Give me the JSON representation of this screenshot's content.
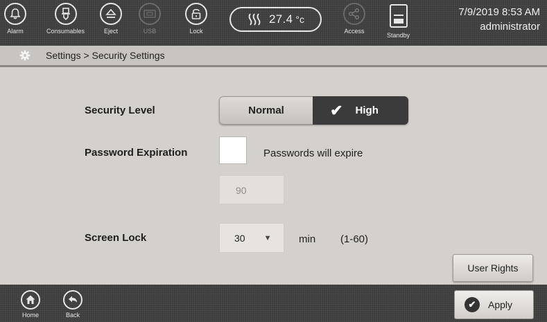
{
  "topbar": {
    "alarm_label": "Alarm",
    "consumables_label": "Consumables",
    "eject_label": "Eject",
    "usb_label": "USB",
    "lock_label": "Lock",
    "temperature": "27.4",
    "temperature_unit": "°c",
    "access_label": "Access",
    "standby_label": "Standby",
    "datetime": "7/9/2019 8:53 AM",
    "user": "administrator"
  },
  "breadcrumb": {
    "text": "Settings > Security Settings"
  },
  "security": {
    "label": "Security Level",
    "options": [
      "Normal",
      "High"
    ],
    "selected": "High"
  },
  "password": {
    "label": "Password Expiration",
    "checkbox_text": "Passwords will expire",
    "checked": false,
    "days_value": "90"
  },
  "screen_lock": {
    "label": "Screen Lock",
    "value": "30",
    "unit": "min",
    "range": "(1-60)"
  },
  "buttons": {
    "user_rights": "User Rights",
    "apply": "Apply"
  },
  "bottombar": {
    "home_label": "Home",
    "back_label": "Back"
  },
  "icons": {
    "alarm": "bell-icon",
    "consumables": "consumables-icon",
    "eject": "eject-icon",
    "usb": "usb-icon",
    "lock": "lock-icon",
    "temperature": "heat-icon",
    "access": "share-icon",
    "standby": "standby-icon",
    "settings": "gear-icon",
    "home": "home-icon",
    "back": "back-icon",
    "apply": "check-icon"
  },
  "colors": {
    "bar_background": "#3d3d3d",
    "content_background": "#d4d0cb",
    "selected_segment": "#3b3b3b"
  }
}
